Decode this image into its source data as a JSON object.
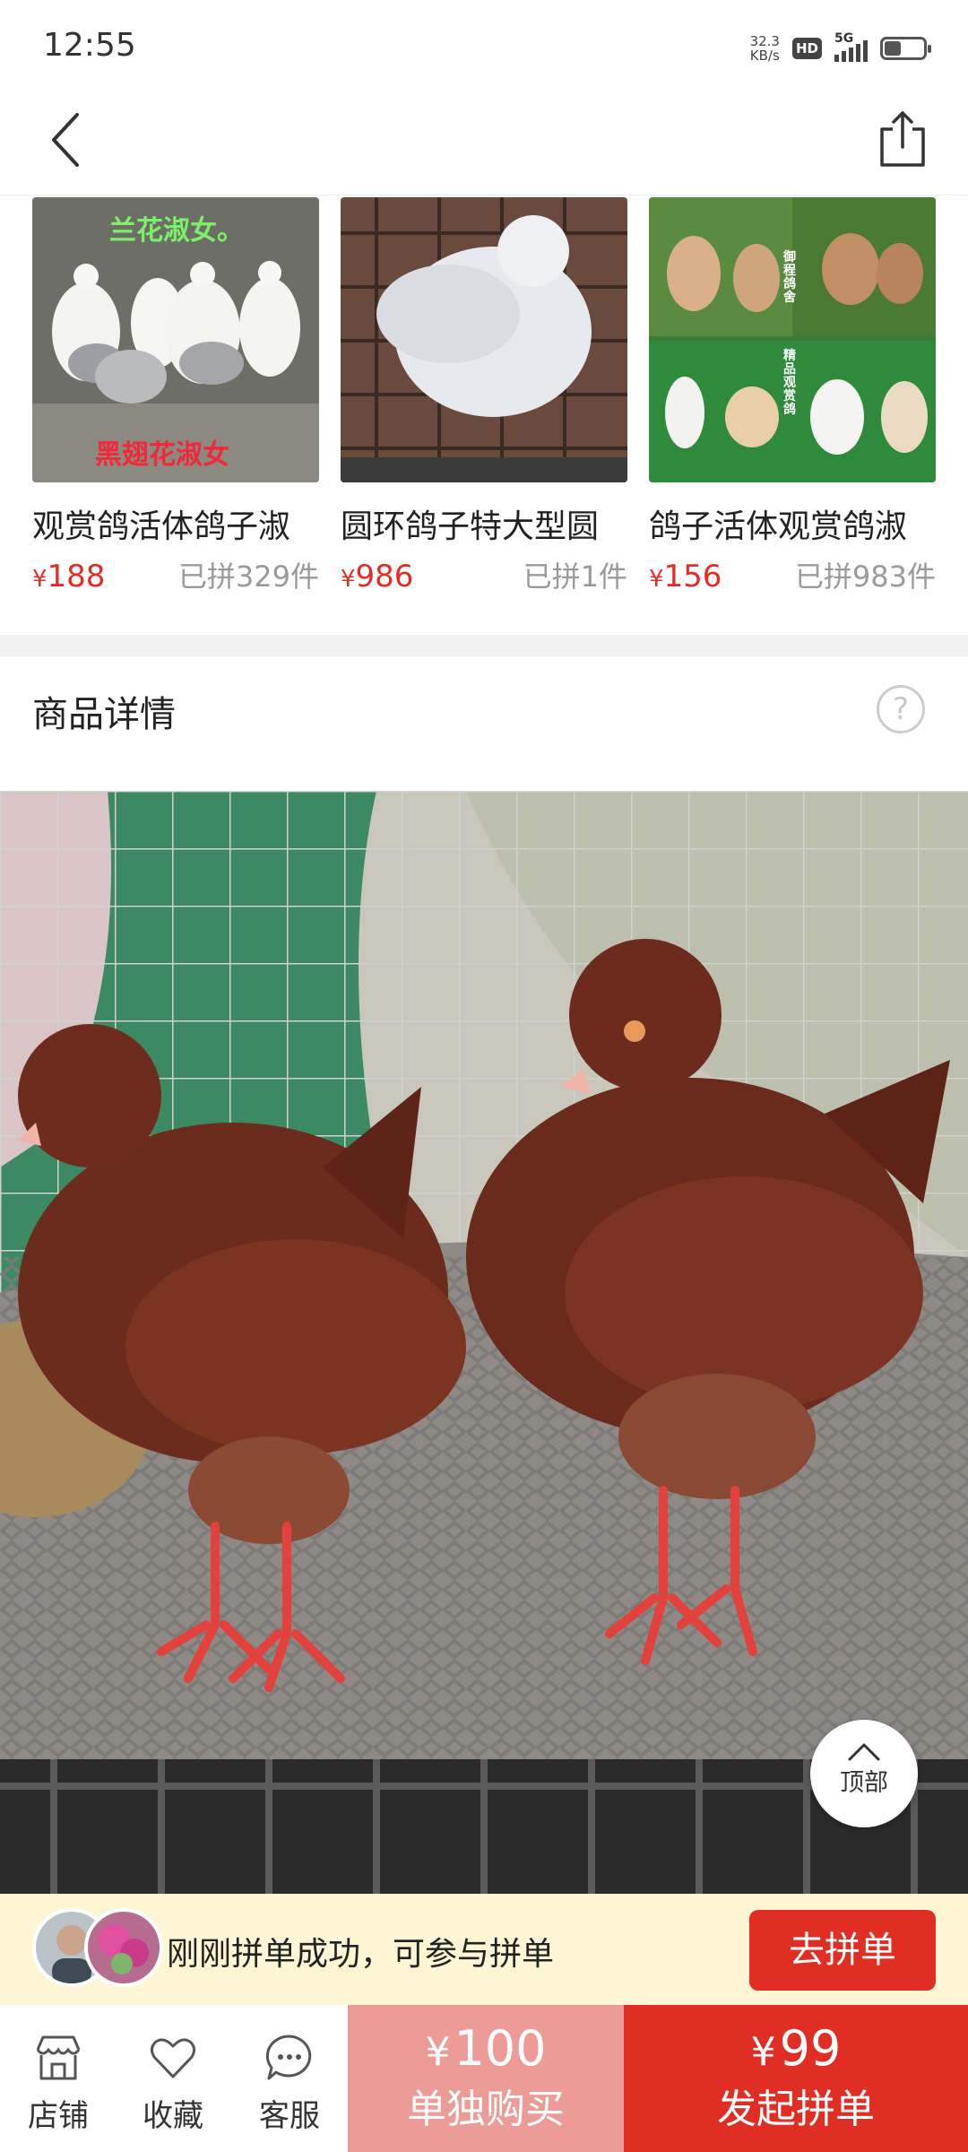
{
  "status_bar": {
    "time": "12:55",
    "net_speed_value": "32.3",
    "net_speed_unit": "KB/s",
    "hd": "HD",
    "network": "5G",
    "icons": [
      "hd-icon",
      "signal-icon",
      "battery-icon"
    ]
  },
  "nav": {
    "icons": [
      "back-arrow-icon",
      "share-icon"
    ]
  },
  "recommendations": [
    {
      "title": "观赏鸽活体鸽子淑",
      "currency": "¥",
      "price": "188",
      "sold": "已拼329件",
      "image_text": [
        "兰花淑女。",
        "黑翅花淑女"
      ]
    },
    {
      "title": "圆环鸽子特大型圆",
      "currency": "¥",
      "price": "986",
      "sold": "已拼1件",
      "image_text": []
    },
    {
      "title": "鸽子活体观赏鸽淑",
      "currency": "¥",
      "price": "156",
      "sold": "已拼983件",
      "image_text": [
        "御程鸽舍",
        "精品观赏鸽"
      ]
    }
  ],
  "detail": {
    "title": "商品详情",
    "help_symbol": "?"
  },
  "back_to_top": {
    "label": "顶部"
  },
  "group_banner": {
    "message": "刚刚拼单成功，可参与拼单",
    "join_label": "去拼单"
  },
  "bottom_bar": {
    "tools": [
      {
        "label": "店铺",
        "icon": "store-icon"
      },
      {
        "label": "收藏",
        "icon": "heart-icon"
      },
      {
        "label": "客服",
        "icon": "chat-icon"
      }
    ],
    "solo": {
      "currency": "¥",
      "price": "100",
      "label": "单独购买"
    },
    "group": {
      "currency": "¥",
      "price": "99",
      "label": "发起拼单"
    }
  },
  "colors": {
    "accent_red": "#e02e24",
    "solo_pink": "#ec9b97",
    "banner_yellow": "#fdf5d3",
    "muted_gray": "#9a9a9a"
  }
}
